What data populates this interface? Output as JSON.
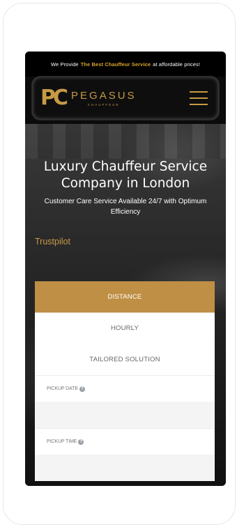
{
  "topbar": {
    "prefix": "We Provide",
    "highlight": "The Best Chauffeur Service",
    "suffix": "at affordable prices!"
  },
  "brand": {
    "monogram": "PC",
    "name": "PEGASUS",
    "tagline": "CHAUFFEUR"
  },
  "hero": {
    "title_line1": "Luxury Chauffeur Service",
    "title_line2": "Company in London",
    "subtitle": "Customer Care Service Available 24/7 with Optimum Efficiency",
    "trustpilot": "Trustpilot"
  },
  "booking": {
    "tabs": [
      {
        "label": "DISTANCE",
        "active": true
      },
      {
        "label": "HOURLY",
        "active": false
      },
      {
        "label": "TAILORED SOLUTION",
        "active": false
      }
    ],
    "fields": [
      {
        "label": "PICKUP DATE",
        "value": ""
      },
      {
        "label": "PICKUP TIME",
        "value": ""
      }
    ]
  },
  "colors": {
    "accent": "#c79a45",
    "active_tab": "#bf8f45",
    "topbar_highlight": "#d9a52a"
  },
  "icons": {
    "menu": "hamburger-menu-icon",
    "help": "question-circle-icon"
  }
}
